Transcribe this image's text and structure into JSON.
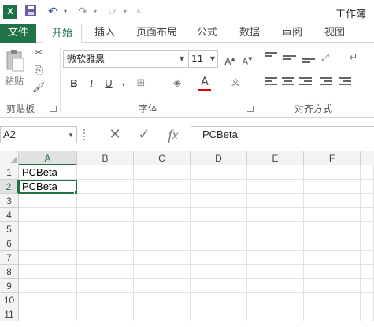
{
  "qat": {
    "app_icon": "X",
    "title": "工作簿",
    "icons": [
      "excel-icon",
      "save-icon",
      "undo-icon",
      "redo-icon",
      "touch-mode-icon",
      "customize-icon"
    ]
  },
  "tabs": [
    {
      "label": "文件"
    },
    {
      "label": "开始"
    },
    {
      "label": "插入"
    },
    {
      "label": "页面布局"
    },
    {
      "label": "公式"
    },
    {
      "label": "数据"
    },
    {
      "label": "审阅"
    },
    {
      "label": "视图"
    }
  ],
  "ribbon": {
    "clipboard": {
      "paste_label": "粘贴",
      "group_label": "剪贴板"
    },
    "font": {
      "font_name": "微软雅黑",
      "font_size": "11",
      "group_label": "字体",
      "bold": "B",
      "italic": "I",
      "underline": "U",
      "font_color_letter": "A"
    },
    "alignment": {
      "group_label": "对齐方式"
    }
  },
  "formula_bar": {
    "name_box": "A2",
    "fx_label": "fx",
    "value": "PCBeta"
  },
  "sheet": {
    "columns": [
      "A",
      "B",
      "C",
      "D",
      "E",
      "F"
    ],
    "rows": [
      "1",
      "2",
      "3",
      "4",
      "5",
      "6",
      "7",
      "8",
      "9",
      "10",
      "11"
    ],
    "selected_cell": "A2",
    "cells": {
      "A1": "PCBeta",
      "A2": "PCBeta"
    }
  },
  "colors": {
    "accent": "#217346",
    "font_color_bar": "#e00000"
  }
}
